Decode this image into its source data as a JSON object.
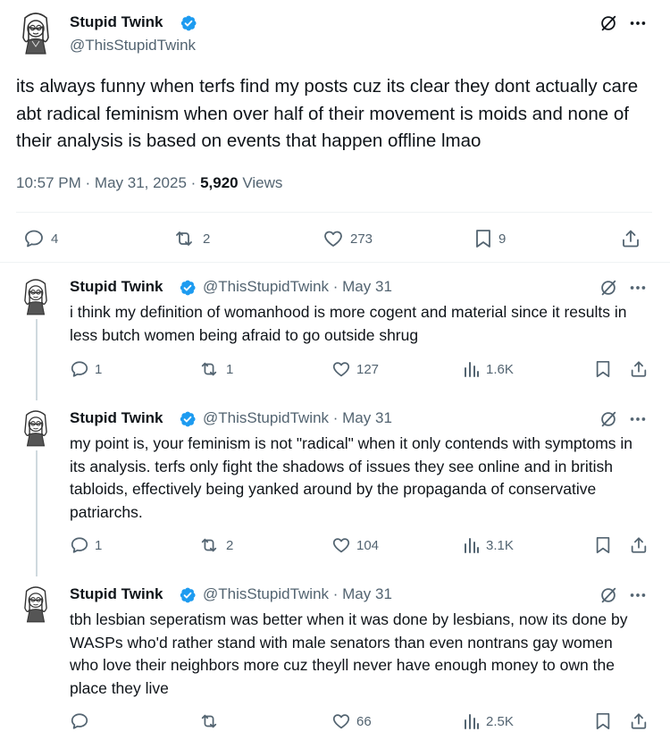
{
  "main_post": {
    "author_name": "Stupid Twink",
    "author_handle": "@ThisStupidTwink",
    "text": "its always funny when terfs find my posts cuz its clear they dont actually care abt radical feminism when over half of their movement is moids and none of their analysis is based on events that happen offline lmao",
    "time": "10:57 PM",
    "date": "May 31, 2025",
    "sep": "·",
    "views_count": "5,920",
    "views_label": "Views",
    "replies": "4",
    "reposts": "2",
    "likes": "273",
    "bookmarks": "9"
  },
  "replies": [
    {
      "author_name": "Stupid Twink",
      "author_handle": "@ThisStupidTwink",
      "date": "· May 31",
      "text": "i think my definition of womanhood is more cogent and material since it results in less butch women being afraid to go outside shrug",
      "replies": "1",
      "reposts": "1",
      "likes": "127",
      "views": "1.6K"
    },
    {
      "author_name": "Stupid Twink",
      "author_handle": "@ThisStupidTwink",
      "date": "· May 31",
      "text": "my point is, your feminism is not \"radical\" when it only contends with symptoms in its analysis. terfs only fight the shadows of issues they see online and in british tabloids, effectively being yanked around by the propaganda of conservative patriarchs.",
      "replies": "1",
      "reposts": "2",
      "likes": "104",
      "views": "3.1K"
    },
    {
      "author_name": "Stupid Twink",
      "author_handle": "@ThisStupidTwink",
      "date": "· May 31",
      "text": "tbh lesbian seperatism was better when it was done by lesbians, now its done by WASPs who'd rather stand with male senators than even nontrans gay women who love their neighbors more cuz theyll never have enough money to own the place they live",
      "replies": "",
      "reposts": "",
      "likes": "66",
      "views": "2.5K"
    }
  ],
  "colors": {
    "verified": "#1d9bf0",
    "text": "#0f1419",
    "secondary": "#536471",
    "divider": "#eff3f4",
    "thread_line": "#cfd9de"
  }
}
